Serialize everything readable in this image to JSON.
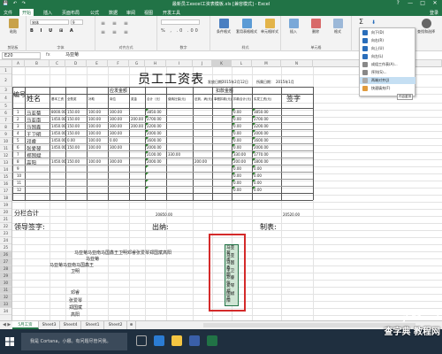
{
  "window": {
    "title": "最新员工excel工资表模板.xls  [兼容模式] - Excel",
    "controls": [
      "?",
      "—",
      "□",
      "✕"
    ]
  },
  "ribbon": {
    "tabs": [
      "文件",
      "开始",
      "插入",
      "页面布局",
      "公式",
      "数据",
      "审阅",
      "视图",
      "开发工具"
    ],
    "active_tab": "开始",
    "sign_in": "登录",
    "font_name": "宋体",
    "font_size": "9",
    "groups": {
      "clipboard": "剪贴板",
      "font": "字体",
      "alignment": "对齐方式",
      "number": "数字",
      "styles": "样式",
      "cells": "单元格"
    },
    "buttons": {
      "paste": "粘贴",
      "conditional_format": "条件格式",
      "format_as_table": "套用表格格式",
      "cell_styles": "单元格样式",
      "insert": "插入",
      "delete": "删除",
      "format": "格式",
      "sort_filter": "排序和筛选",
      "find_select": "查找和选择"
    }
  },
  "fill_menu": {
    "items": [
      {
        "label": "向下(D)",
        "highlighted": false
      },
      {
        "label": "向右(R)",
        "highlighted": false
      },
      {
        "label": "向上(U)",
        "highlighted": false
      },
      {
        "label": "向左(L)",
        "highlighted": false
      },
      {
        "label": "成组工作表(A)...",
        "highlighted": false
      },
      {
        "label": "序列(S)...",
        "highlighted": false
      },
      {
        "label": "两端对齐(J)",
        "highlighted": true
      },
      {
        "label": "快速填充(F)",
        "highlighted": false
      }
    ],
    "tooltip": "内容重排"
  },
  "formula_bar": {
    "name_box": "E20",
    "fx": "fx",
    "value": "马亚菊"
  },
  "columns": [
    "A",
    "B",
    "C",
    "D",
    "E",
    "F",
    "G",
    "H",
    "I",
    "J",
    "K",
    "L",
    "M",
    "N",
    "O"
  ],
  "selected_column": "K",
  "rows": [
    "1",
    "2",
    "3",
    "4",
    "5",
    "6",
    "7",
    "8",
    "9",
    "10",
    "11",
    "12",
    "13",
    "14",
    "15",
    "16",
    "17",
    "18",
    "19",
    "20",
    "21",
    "22",
    "23",
    "24",
    "25",
    "26",
    "27",
    "28",
    "29",
    "30",
    "31",
    "32",
    "33",
    "34"
  ],
  "sheet": {
    "title": "员工工资表",
    "issue_date_label": "发放日期：",
    "issue_date": "2015年2月12日",
    "period_label": "所属日期：",
    "period": "2015年1月",
    "headers": {
      "no": "编号",
      "name": "姓名",
      "salary_group": "应发金额",
      "deduct_group": "扣款金额",
      "basic": "基本工资",
      "full_attendance": "全勤奖",
      "subsidy": "补助",
      "position": "岗位",
      "bonus": "奖金",
      "total": "合计（元）",
      "insurance": "缴纳社保(元)",
      "absence": "迟到、病(元)",
      "leave": "事假扣款(元)",
      "deduct_total": "扣款合计(元)",
      "net": "实发工资(元)",
      "sign": "签字"
    },
    "data_rows": [
      {
        "no": "1",
        "name": "马亚菊",
        "basic": "8000.00",
        "full": "150.00",
        "subsidy": "100.00",
        "position": "300.00",
        "bonus": "",
        "total": "3850.00",
        "ins": "",
        "abs": "",
        "leave": "",
        "dt": "0.00",
        "net": "3850.00"
      },
      {
        "no": "2",
        "name": "马亚南",
        "basic": "1450.00",
        "full": "150.00",
        "subsidy": "100.00",
        "position": "300.00",
        "bonus": "200.00",
        "total": "2700.00",
        "ins": "",
        "abs": "",
        "leave": "",
        "dt": "0.00",
        "net": "2700.00"
      },
      {
        "no": "3",
        "name": "马国鑫",
        "basic": "1450.00",
        "full": "150.00",
        "subsidy": "100.00",
        "position": "300.00",
        "bonus": "200.00",
        "total": "2200.00",
        "ins": "",
        "abs": "",
        "leave": "",
        "dt": "0.00",
        "net": "2200.00"
      },
      {
        "no": "4",
        "name": "王卫明",
        "basic": "1450.00",
        "full": "150.00",
        "subsidy": "100.00",
        "position": "300.00",
        "bonus": "",
        "total": "2000.00",
        "ins": "",
        "abs": "",
        "leave": "",
        "dt": "0.00",
        "net": "2000.00"
      },
      {
        "no": "5",
        "name": "邓睿",
        "basic": "1450.00",
        "full": "0.00",
        "subsidy": "100.00",
        "position": "0.00",
        "bonus": "",
        "total": "1600.00",
        "ins": "",
        "abs": "",
        "leave": "",
        "dt": "0.00",
        "net": "1600.00"
      },
      {
        "no": "6",
        "name": "张爱琴",
        "basic": "1450.00",
        "full": "150.00",
        "subsidy": "100.00",
        "position": "300.00",
        "bonus": "",
        "total": "2000.00",
        "ins": "",
        "abs": "",
        "leave": "",
        "dt": "0.00",
        "net": "2000.00"
      },
      {
        "no": "7",
        "name": "郑国斌",
        "basic": "",
        "full": "",
        "subsidy": "",
        "position": "",
        "bonus": "",
        "total": "2100.00",
        "ins": "330.00",
        "abs": "",
        "leave": "",
        "dt": "330.00",
        "net": "1770.00"
      },
      {
        "no": "8",
        "name": "高阳",
        "basic": "1450.00",
        "full": "150.00",
        "subsidy": "100.00",
        "position": "300.00",
        "bonus": "",
        "total": "2000.00",
        "ins": "",
        "abs": "200.00",
        "leave": "",
        "dt": "200.00",
        "net": "1800.00"
      },
      {
        "no": "9",
        "name": "",
        "basic": "",
        "full": "",
        "subsidy": "",
        "position": "",
        "bonus": "",
        "total": "",
        "ins": "",
        "abs": "",
        "leave": "",
        "dt": "0.00",
        "net": "0.00"
      },
      {
        "no": "10",
        "name": "",
        "basic": "",
        "full": "",
        "subsidy": "",
        "position": "",
        "bonus": "",
        "total": "",
        "ins": "",
        "abs": "",
        "leave": "",
        "dt": "0.00",
        "net": "0.00"
      },
      {
        "no": "11",
        "name": "",
        "basic": "",
        "full": "",
        "subsidy": "",
        "position": "",
        "bonus": "",
        "total": "",
        "ins": "",
        "abs": "",
        "leave": "",
        "dt": "0.00",
        "net": "0.00"
      },
      {
        "no": "12",
        "name": "",
        "basic": "",
        "full": "",
        "subsidy": "",
        "position": "",
        "bonus": "",
        "total": "",
        "ins": "",
        "abs": "",
        "leave": "",
        "dt": "0.00",
        "net": "0.00"
      }
    ],
    "subtotal_label": "分栏合计",
    "subtotal_total": "20850.00",
    "subtotal_net": "20520.00",
    "footer": {
      "leader_sign": "领导签字:",
      "cashier": "出纳:",
      "preparer": "制表:"
    },
    "scratch_lines": [
      "马亚菊马亚南马国鑫王卫明邓睿张爱琴郑国斌高阳",
      "马亚菊",
      "马亚菊马亚南马国鑫王",
      "卫明",
      "邓睿",
      "张爱琴",
      "郑国斌",
      "高阳"
    ],
    "selected_block": [
      "马亚菊",
      "马亚南",
      "马国鑫",
      "王卫明",
      "邓睿张",
      "爱琴郑",
      "国斌高",
      "阳"
    ]
  },
  "sheet_tabs": [
    "5月工资",
    "Sheet3",
    "Sheet4",
    "Sheet1",
    "Sheet2",
    "⊕"
  ],
  "active_sheet": "5月工资",
  "taskbar": {
    "search_placeholder": "我是 Cortana，小娜。有问题尽管问我。"
  },
  "watermark": {
    "line1": "jb51.net",
    "line2": "查字典 教程网"
  }
}
